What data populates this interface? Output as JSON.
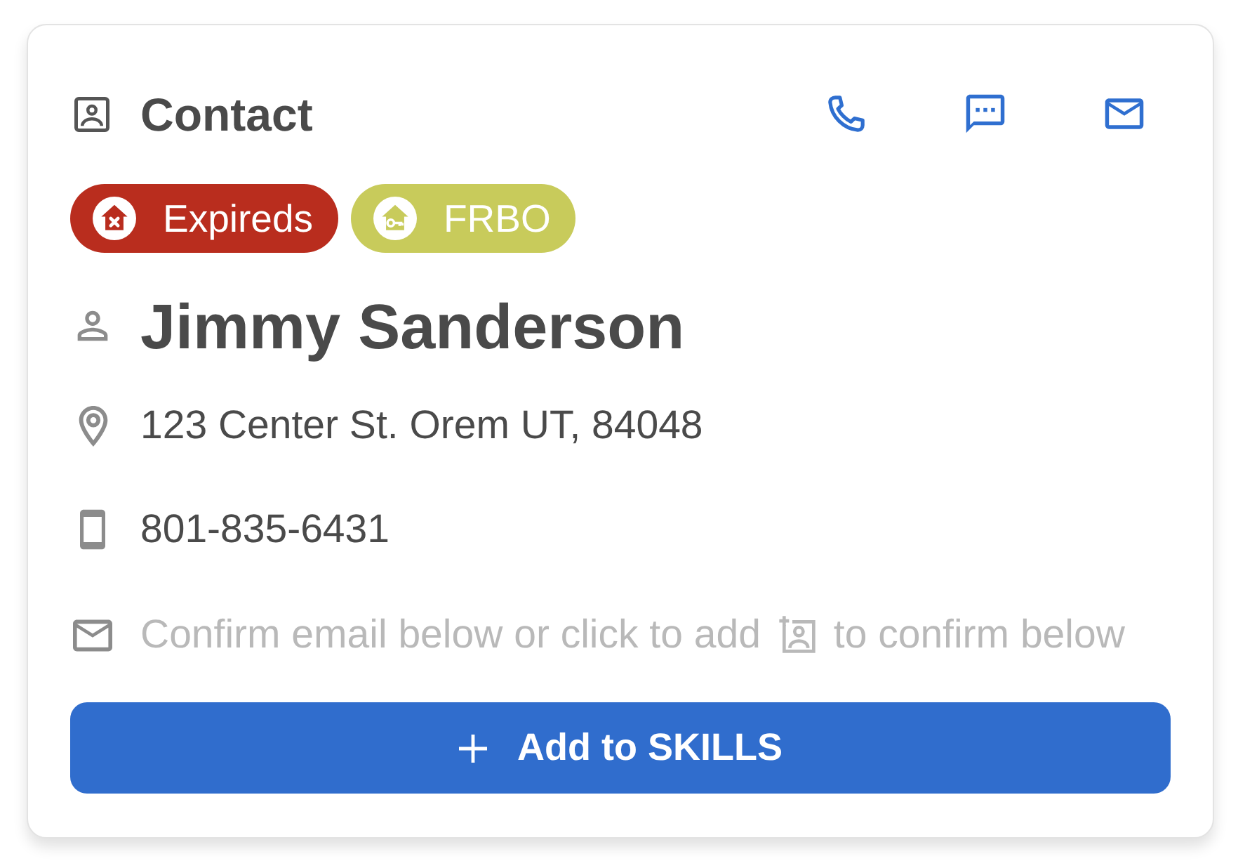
{
  "header": {
    "title": "Contact"
  },
  "tags": [
    {
      "kind": "expired",
      "label": "Expireds",
      "color": "#b92d1e"
    },
    {
      "kind": "frbo",
      "label": "FRBO",
      "color": "#c8cb5b"
    }
  ],
  "name": "Jimmy Sanderson",
  "address": "123 Center St. Orem UT, 84048",
  "phone": "801-835-6431",
  "email_hint": {
    "before": "Confirm email below or click to add",
    "after": "to confirm below"
  },
  "primary_button": {
    "label": "Add to SKILLS"
  }
}
